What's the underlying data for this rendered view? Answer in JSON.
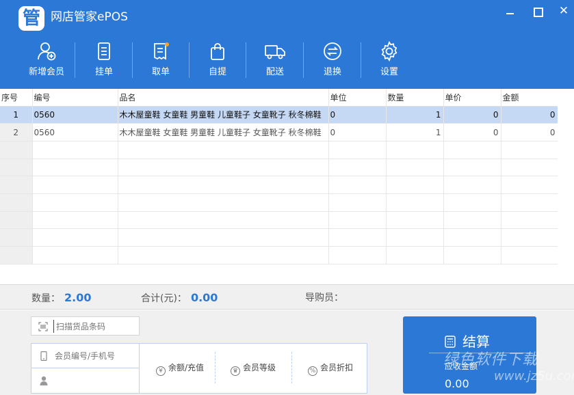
{
  "app": {
    "logo_text": "管",
    "title": "网店管家ePOS"
  },
  "window": {
    "minimize": "",
    "maximize": "",
    "close": "✕"
  },
  "toolbar": [
    {
      "label": "新增会员",
      "icon": "add-member-icon"
    },
    {
      "label": "挂单",
      "icon": "hold-order-icon"
    },
    {
      "label": "取单",
      "icon": "retrieve-order-icon"
    },
    {
      "label": "自提",
      "icon": "pickup-bag-icon"
    },
    {
      "label": "配送",
      "icon": "delivery-truck-icon"
    },
    {
      "label": "退换",
      "icon": "return-exchange-icon"
    },
    {
      "label": "设置",
      "icon": "gear-icon"
    }
  ],
  "table": {
    "columns": [
      "序号",
      "编号",
      "品名",
      "单位",
      "数量",
      "单价",
      "金额"
    ],
    "rows": [
      {
        "idx": "1",
        "code": "0560",
        "name": "木木屋童鞋 女童鞋 男童鞋 儿童鞋子 女童靴子 秋冬棉鞋",
        "unit": "0",
        "qty": "1",
        "price": "0",
        "amount": "0",
        "selected": true
      },
      {
        "idx": "2",
        "code": "0560",
        "name": "木木屋童鞋 女童鞋 男童鞋 儿童鞋子 女童靴子 秋冬棉鞋",
        "unit": "0",
        "qty": "1",
        "price": "0",
        "amount": "0",
        "selected": false
      }
    ]
  },
  "summary": {
    "qty_label": "数量：",
    "qty_value": "2.00",
    "total_label": "合计(元)：",
    "total_value": "0.00",
    "guide_label": "导购员："
  },
  "scan": {
    "placeholder": "扫描货品条码"
  },
  "member": {
    "id_placeholder": "会员编号/手机号",
    "name_placeholder": "",
    "balance_label": "余额/充值",
    "level_label": "会员等级",
    "discount_label": "会员折扣"
  },
  "checkout": {
    "title": "结算",
    "receivable_label": "应收金额",
    "receivable_value": "0.00"
  },
  "watermark": {
    "text1": "绿色软件下载",
    "text2": "www.jz5u.com"
  },
  "colors": {
    "brand_blue": "#2b78d6",
    "selected_row": "#c5d9f5",
    "panel_gray": "#f0f0f0"
  }
}
